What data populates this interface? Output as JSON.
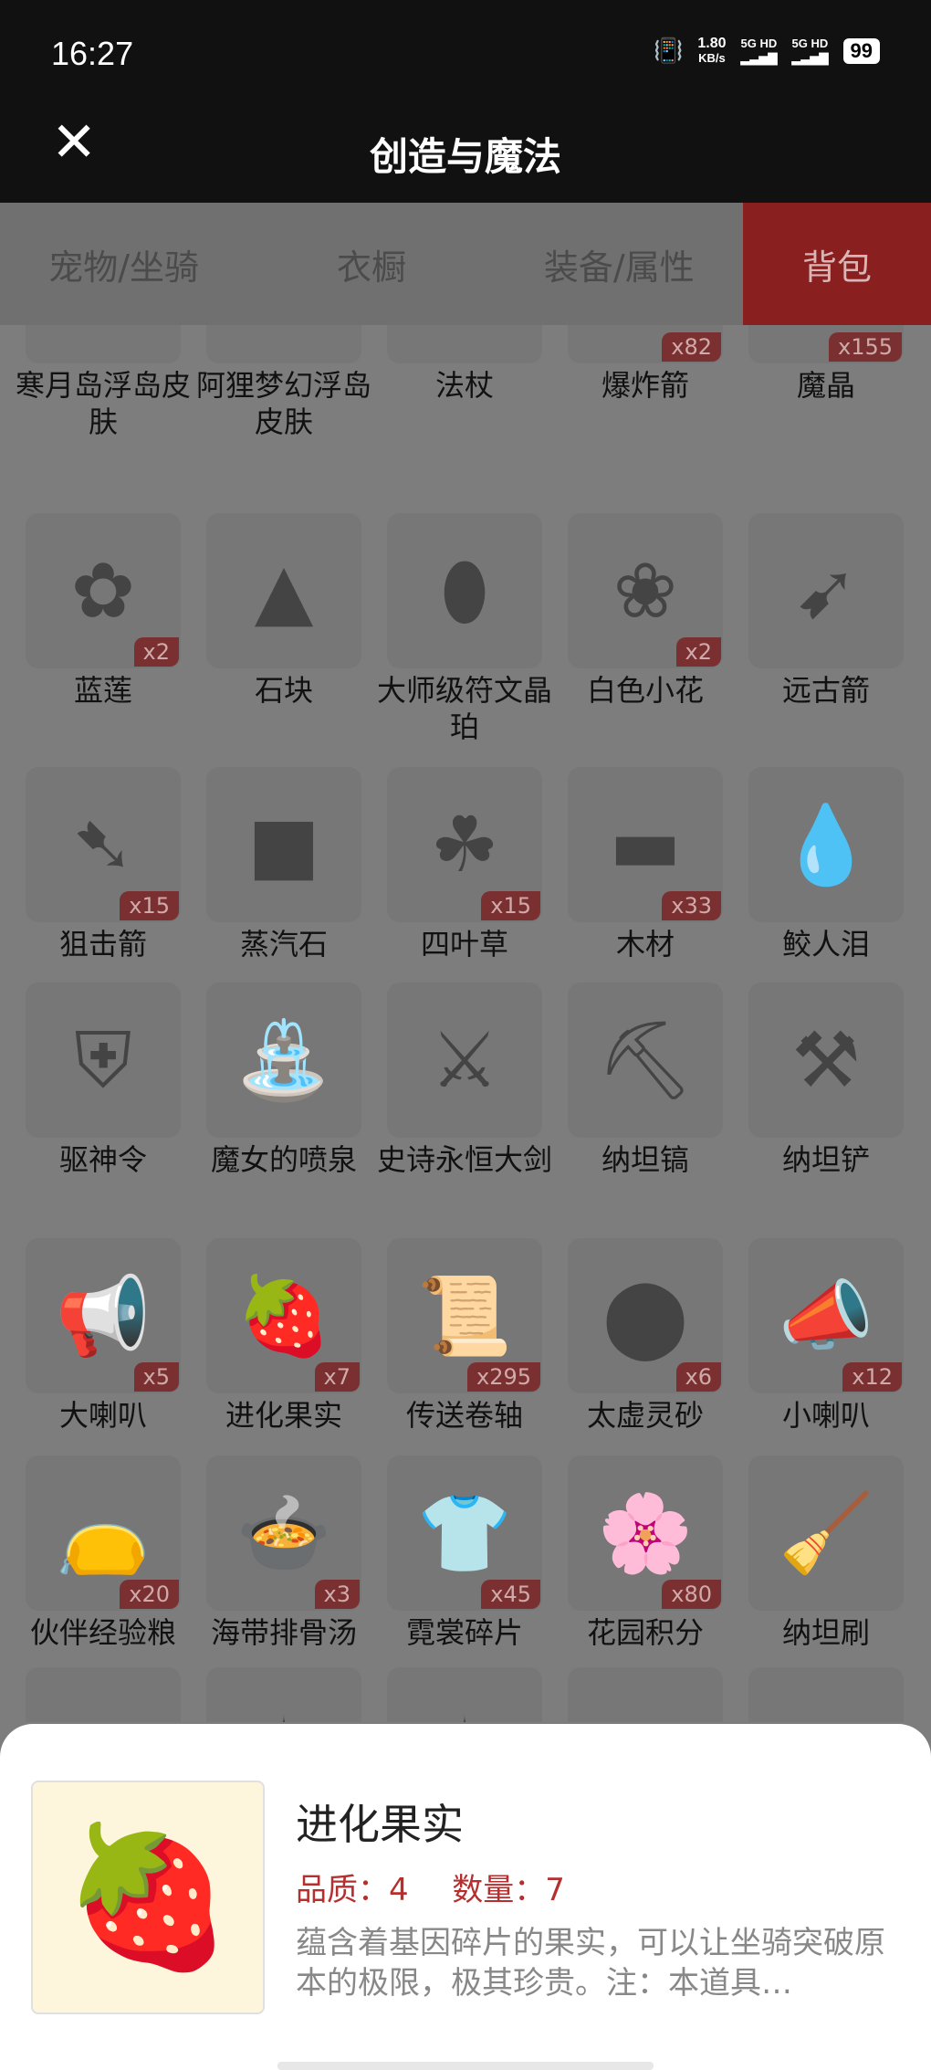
{
  "status": {
    "time": "16:27",
    "speed": "1.80",
    "speed_unit": "KB/s",
    "net1": "5G HD",
    "net2": "5G HD",
    "battery": "99"
  },
  "header": {
    "title": "创造与魔法"
  },
  "tabs": [
    {
      "label": "宠物/坐骑",
      "active": false
    },
    {
      "label": "衣橱",
      "active": false
    },
    {
      "label": "装备/属性",
      "active": false
    },
    {
      "label": "背包",
      "active": true
    }
  ],
  "items": [
    {
      "label": "寒月岛浮岛皮肤",
      "count": "",
      "icon": "island-icon",
      "glyph": "🏝"
    },
    {
      "label": "阿狸梦幻浮岛皮肤",
      "count": "",
      "icon": "dream-island-icon",
      "glyph": "☁"
    },
    {
      "label": "法杖",
      "count": "",
      "icon": "staff-icon",
      "glyph": "⚚"
    },
    {
      "label": "爆炸箭",
      "count": "x82",
      "icon": "explosive-arrow-icon",
      "glyph": "➶"
    },
    {
      "label": "魔晶",
      "count": "x155",
      "icon": "crystal-icon",
      "glyph": "◆"
    },
    {
      "label": "蓝莲",
      "count": "x2",
      "icon": "blue-lotus-icon",
      "glyph": "✿"
    },
    {
      "label": "石块",
      "count": "",
      "icon": "stone-icon",
      "glyph": "▲"
    },
    {
      "label": "大师级符文晶珀",
      "count": "",
      "icon": "rune-amber-icon",
      "glyph": "⬮"
    },
    {
      "label": "白色小花",
      "count": "x2",
      "icon": "white-flower-icon",
      "glyph": "❀"
    },
    {
      "label": "远古箭",
      "count": "",
      "icon": "ancient-arrow-icon",
      "glyph": "➹"
    },
    {
      "label": "狙击箭",
      "count": "x15",
      "icon": "sniper-arrow-icon",
      "glyph": "➷"
    },
    {
      "label": "蒸汽石",
      "count": "",
      "icon": "steam-stone-icon",
      "glyph": "■"
    },
    {
      "label": "四叶草",
      "count": "x15",
      "icon": "clover-icon",
      "glyph": "☘"
    },
    {
      "label": "木材",
      "count": "x33",
      "icon": "wood-icon",
      "glyph": "▬"
    },
    {
      "label": "鲛人泪",
      "count": "",
      "icon": "tear-drop-icon",
      "glyph": "💧"
    },
    {
      "label": "驱神令",
      "count": "",
      "icon": "talisman-icon",
      "glyph": "⛨"
    },
    {
      "label": "魔女的喷泉",
      "count": "",
      "icon": "fountain-icon",
      "glyph": "⛲"
    },
    {
      "label": "史诗永恒大剑",
      "count": "",
      "icon": "sword-icon",
      "glyph": "⚔"
    },
    {
      "label": "纳坦镐",
      "count": "",
      "icon": "pickaxe-icon",
      "glyph": "⛏"
    },
    {
      "label": "纳坦铲",
      "count": "",
      "icon": "shovel-icon",
      "glyph": "⚒"
    },
    {
      "label": "大喇叭",
      "count": "x5",
      "icon": "megaphone-icon",
      "glyph": "📢"
    },
    {
      "label": "进化果实",
      "count": "x7",
      "icon": "evolution-fruit-icon",
      "glyph": "🍓"
    },
    {
      "label": "传送卷轴",
      "count": "x295",
      "icon": "scroll-icon",
      "glyph": "📜"
    },
    {
      "label": "太虚灵砂",
      "count": "x6",
      "icon": "spirit-sand-icon",
      "glyph": "⬤"
    },
    {
      "label": "小喇叭",
      "count": "x12",
      "icon": "small-horn-icon",
      "glyph": "📣"
    },
    {
      "label": "伙伴经验粮",
      "count": "x20",
      "icon": "food-bag-icon",
      "glyph": "👝"
    },
    {
      "label": "海带排骨汤",
      "count": "x3",
      "icon": "soup-icon",
      "glyph": "🍲"
    },
    {
      "label": "霓裳碎片",
      "count": "x45",
      "icon": "clothing-shard-icon",
      "glyph": "👕"
    },
    {
      "label": "花园积分",
      "count": "x80",
      "icon": "garden-points-icon",
      "glyph": "🌸"
    },
    {
      "label": "纳坦刷",
      "count": "",
      "icon": "brush-icon",
      "glyph": "🧹"
    },
    {
      "label": "",
      "count": "",
      "icon": "partial-item-icon",
      "glyph": "◆"
    },
    {
      "label": "",
      "count": "",
      "icon": "partial-item-icon",
      "glyph": "✦"
    },
    {
      "label": "",
      "count": "",
      "icon": "partial-item-icon",
      "glyph": "✧"
    },
    {
      "label": "",
      "count": "",
      "icon": "partial-item-icon",
      "glyph": "➳"
    },
    {
      "label": "",
      "count": "",
      "icon": "partial-item-icon",
      "glyph": "●"
    }
  ],
  "detail": {
    "name": "进化果实",
    "quality_label": "品质：",
    "quality": "4",
    "quantity_label": "数量：",
    "quantity": "7",
    "description": "蕴含着基因碎片的果实，可以让坐骑突破原本的极限，极其珍贵。注：本道具…",
    "icon": "evolution-fruit-icon",
    "glyph": "🍓"
  },
  "colors": {
    "active_tab": "#8a1f1f",
    "badge": "#7a3030",
    "accent_text": "#b52f2f"
  }
}
